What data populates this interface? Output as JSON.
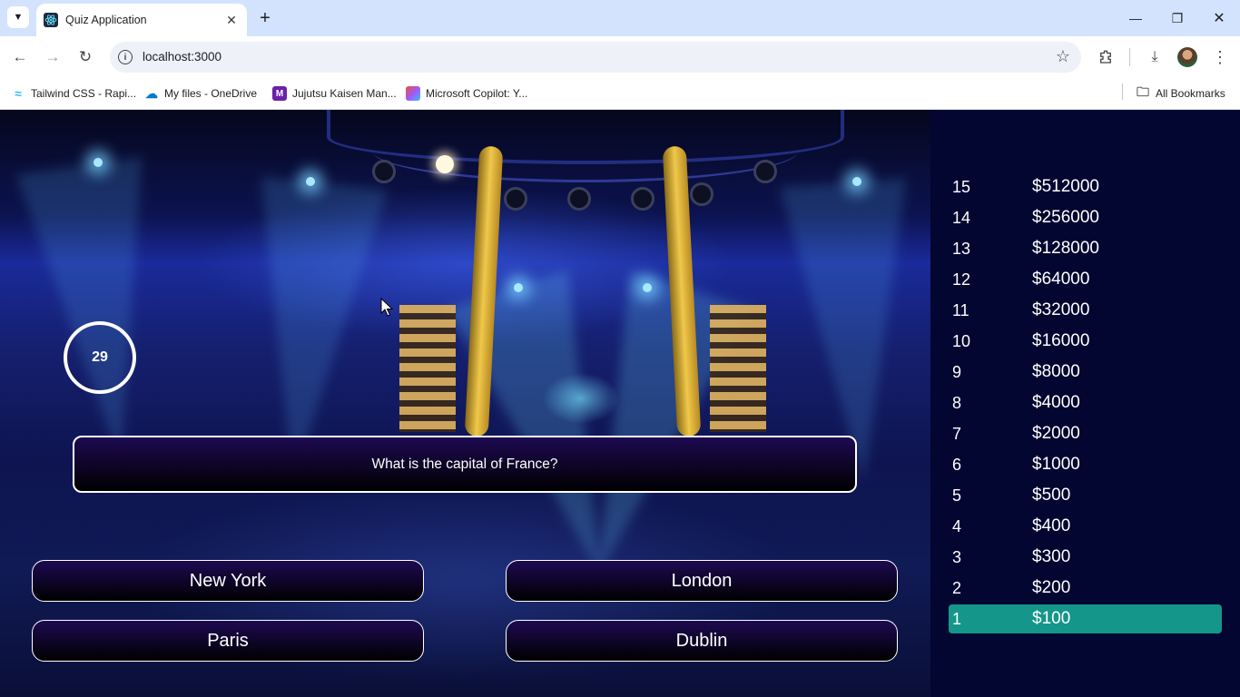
{
  "browser": {
    "tab_title": "Quiz Application",
    "url": "localhost:3000",
    "bookmarks": [
      {
        "label": "Tailwind CSS - Rapi...",
        "icon": "tailwind-icon",
        "color": "#38bdf8"
      },
      {
        "label": "My files - OneDrive",
        "icon": "onedrive-icon",
        "color": "#0078d4"
      },
      {
        "label": "Jujutsu Kaisen Man...",
        "icon": "manga-icon",
        "color": "#6b21a8"
      },
      {
        "label": "Microsoft Copilot: Y...",
        "icon": "copilot-icon",
        "color": "#e4572e"
      }
    ],
    "all_bookmarks_label": "All Bookmarks"
  },
  "quiz": {
    "timer": "29",
    "question": "What is the capital of France?",
    "answers": [
      "New York",
      "London",
      "Paris",
      "Dublin"
    ]
  },
  "money_pyramid": {
    "active_level": 1,
    "active_color": "#14968a",
    "levels": [
      {
        "number": "15",
        "amount": "$512000"
      },
      {
        "number": "14",
        "amount": "$256000"
      },
      {
        "number": "13",
        "amount": "$128000"
      },
      {
        "number": "12",
        "amount": "$64000"
      },
      {
        "number": "11",
        "amount": "$32000"
      },
      {
        "number": "10",
        "amount": "$16000"
      },
      {
        "number": "9",
        "amount": "$8000"
      },
      {
        "number": "8",
        "amount": "$4000"
      },
      {
        "number": "7",
        "amount": "$2000"
      },
      {
        "number": "6",
        "amount": "$1000"
      },
      {
        "number": "5",
        "amount": "$500"
      },
      {
        "number": "4",
        "amount": "$400"
      },
      {
        "number": "3",
        "amount": "$300"
      },
      {
        "number": "2",
        "amount": "$200"
      },
      {
        "number": "1",
        "amount": "$100"
      }
    ]
  }
}
